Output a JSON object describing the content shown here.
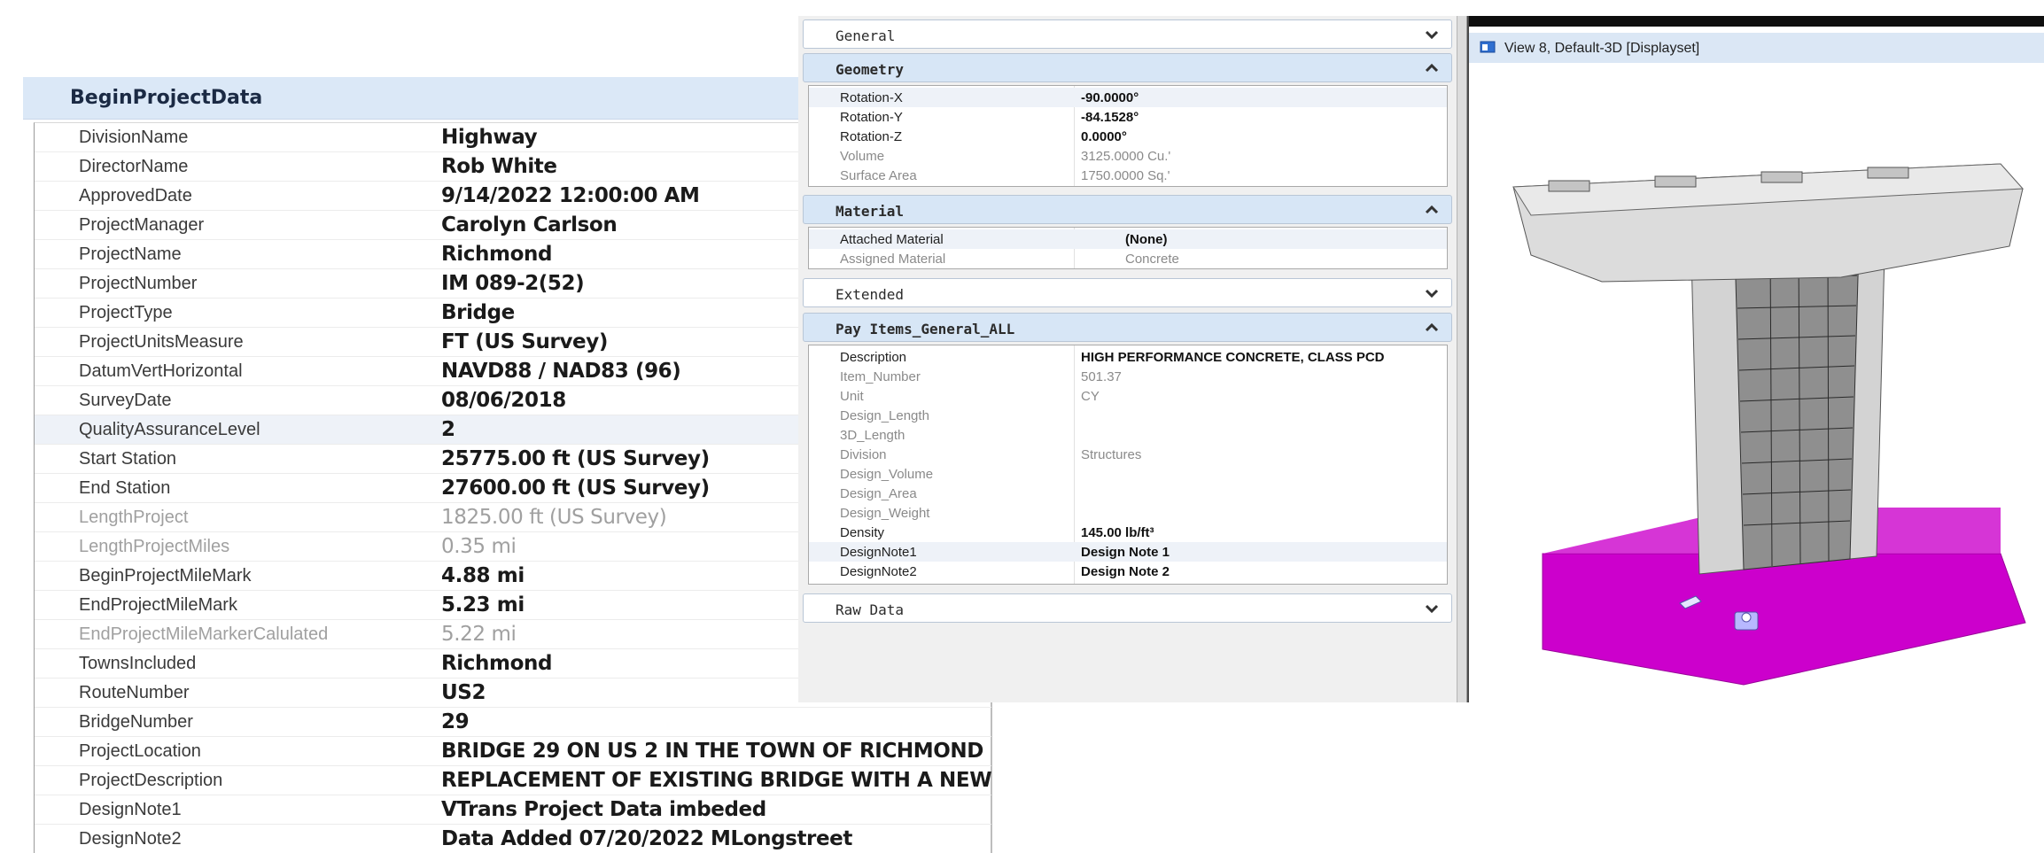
{
  "begin_project": {
    "header": "BeginProjectData",
    "rows": [
      {
        "name": "DivisionName",
        "value": "Highway"
      },
      {
        "name": "DirectorName",
        "value": "Rob White"
      },
      {
        "name": "ApprovedDate",
        "value": "9/14/2022 12:00:00 AM"
      },
      {
        "name": "ProjectManager",
        "value": "Carolyn Carlson"
      },
      {
        "name": "ProjectName",
        "value": "Richmond"
      },
      {
        "name": "ProjectNumber",
        "value": "IM 089-2(52)"
      },
      {
        "name": "ProjectType",
        "value": "Bridge"
      },
      {
        "name": "ProjectUnitsMeasure",
        "value": "FT (US Survey)"
      },
      {
        "name": "DatumVertHorizontal",
        "value": "NAVD88 / NAD83 (96)"
      },
      {
        "name": "SurveyDate",
        "value": "08/06/2018"
      },
      {
        "name": "QualityAssuranceLevel",
        "value": "2"
      },
      {
        "name": "Start Station",
        "value": "25775.00 ft (US Survey)"
      },
      {
        "name": "End Station",
        "value": "27600.00 ft (US Survey)"
      },
      {
        "name": "LengthProject",
        "value": "1825.00 ft (US Survey)"
      },
      {
        "name": "LengthProjectMiles",
        "value": "0.35 mi"
      },
      {
        "name": "BeginProjectMileMark",
        "value": "4.88 mi"
      },
      {
        "name": "EndProjectMileMark",
        "value": "5.23 mi"
      },
      {
        "name": "EndProjectMileMarkerCalulated",
        "value": "5.22 mi"
      },
      {
        "name": "TownsIncluded",
        "value": "Richmond"
      },
      {
        "name": "RouteNumber",
        "value": "US2"
      },
      {
        "name": "BridgeNumber",
        "value": "29"
      },
      {
        "name": "ProjectLocation",
        "value": "BRIDGE 29 ON US 2 IN THE TOWN OF RICHMOND"
      },
      {
        "name": "ProjectDescription",
        "value": "REPLACEMENT OF EXISTING BRIDGE WITH A NEW"
      },
      {
        "name": "DesignNote1",
        "value": "VTrans Project Data imbeded"
      },
      {
        "name": "DesignNote2",
        "value": "Data Added 07/20/2022 MLongstreet"
      }
    ]
  },
  "properties": {
    "general": "General",
    "geometry": {
      "title": "Geometry",
      "rows": [
        {
          "name": "Rotation-X",
          "value": "-90.0000°"
        },
        {
          "name": "Rotation-Y",
          "value": "-84.1528°"
        },
        {
          "name": "Rotation-Z",
          "value": "0.0000°"
        },
        {
          "name": "Volume",
          "value": "3125.0000 Cu.'"
        },
        {
          "name": "Surface Area",
          "value": "1750.0000 Sq.'"
        }
      ]
    },
    "material": {
      "title": "Material",
      "rows": [
        {
          "name": "Attached Material",
          "value": "(None)"
        },
        {
          "name": "Assigned Material",
          "value": "Concrete"
        }
      ]
    },
    "extended": "Extended",
    "pay_items": {
      "title": "Pay Items_General_ALL",
      "rows": [
        {
          "name": "Description",
          "value": "HIGH PERFORMANCE CONCRETE, CLASS PCD"
        },
        {
          "name": "Item_Number",
          "value": "501.37"
        },
        {
          "name": "Unit",
          "value": "CY"
        },
        {
          "name": "Design_Length",
          "value": ""
        },
        {
          "name": "3D_Length",
          "value": ""
        },
        {
          "name": "Division",
          "value": "Structures"
        },
        {
          "name": "Design_Volume",
          "value": ""
        },
        {
          "name": "Design_Area",
          "value": ""
        },
        {
          "name": "Design_Weight",
          "value": ""
        },
        {
          "name": "Density",
          "value": "145.00 lb/ft³"
        },
        {
          "name": "DesignNote1",
          "value": "Design Note 1"
        },
        {
          "name": "DesignNote2",
          "value": "Design Note 2"
        }
      ]
    },
    "raw_data": "Raw Data"
  },
  "view": {
    "title": "View 8, Default-3D [Displayset]",
    "icons": [
      "view-window-icon"
    ],
    "colors": {
      "pier": "#c9c9c9",
      "base": "#cc00cc"
    }
  }
}
